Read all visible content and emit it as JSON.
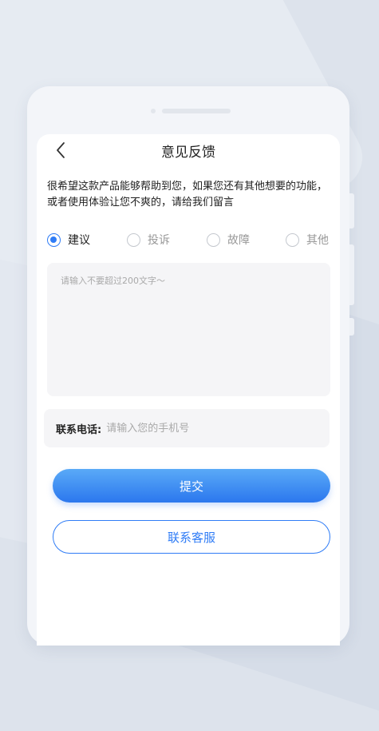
{
  "header": {
    "title": "意见反馈"
  },
  "intro": {
    "text": "很希望这款产品能够帮助到您，如果您还有其他想要的功能，或者使用体验让您不爽的，请给我们留言"
  },
  "feedback_types": [
    {
      "label": "建议",
      "checked": true
    },
    {
      "label": "投诉",
      "checked": false
    },
    {
      "label": "故障",
      "checked": false
    },
    {
      "label": "其他",
      "checked": false
    }
  ],
  "content_input": {
    "placeholder": "请输入不要超过200文字～",
    "value": ""
  },
  "phone": {
    "label": "联系电话:",
    "placeholder": "请输入您的手机号",
    "value": ""
  },
  "actions": {
    "submit_label": "提交",
    "service_label": "联系客服"
  },
  "colors": {
    "accent": "#2f7cf6",
    "gradient_top": "#5aaaf7",
    "gradient_bottom": "#2b77ee",
    "field_background": "#f5f5f7",
    "page_background": "#dde3ec"
  },
  "icons": {
    "back": "chevron-left-icon"
  }
}
